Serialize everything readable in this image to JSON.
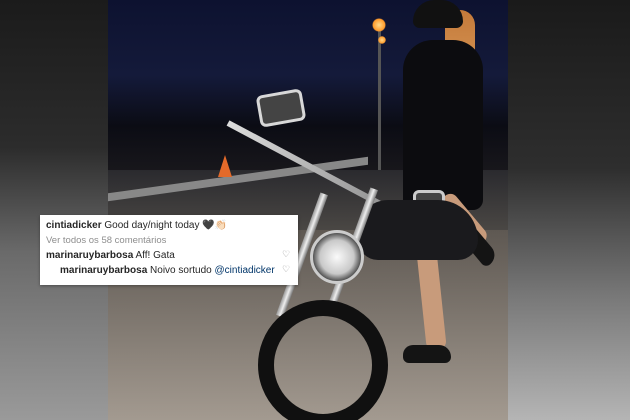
{
  "post": {
    "caption_user": "cintiadicker",
    "caption_text": "Good day/night today 🖤👏🏻",
    "view_all_comments": "Ver todos os 58 comentários",
    "comments": [
      {
        "user": "marinaruybarbosa",
        "text": "Aff! Gata"
      },
      {
        "user": "marinaruybarbosa",
        "text": "Noivo sortudo",
        "mention": "@cintiadicker"
      }
    ]
  },
  "icons": {
    "like": "heart-outline-icon"
  },
  "colors": {
    "username": "#262626",
    "muted": "#8e8e8e",
    "mention": "#003569",
    "card_bg": "#ffffff"
  }
}
